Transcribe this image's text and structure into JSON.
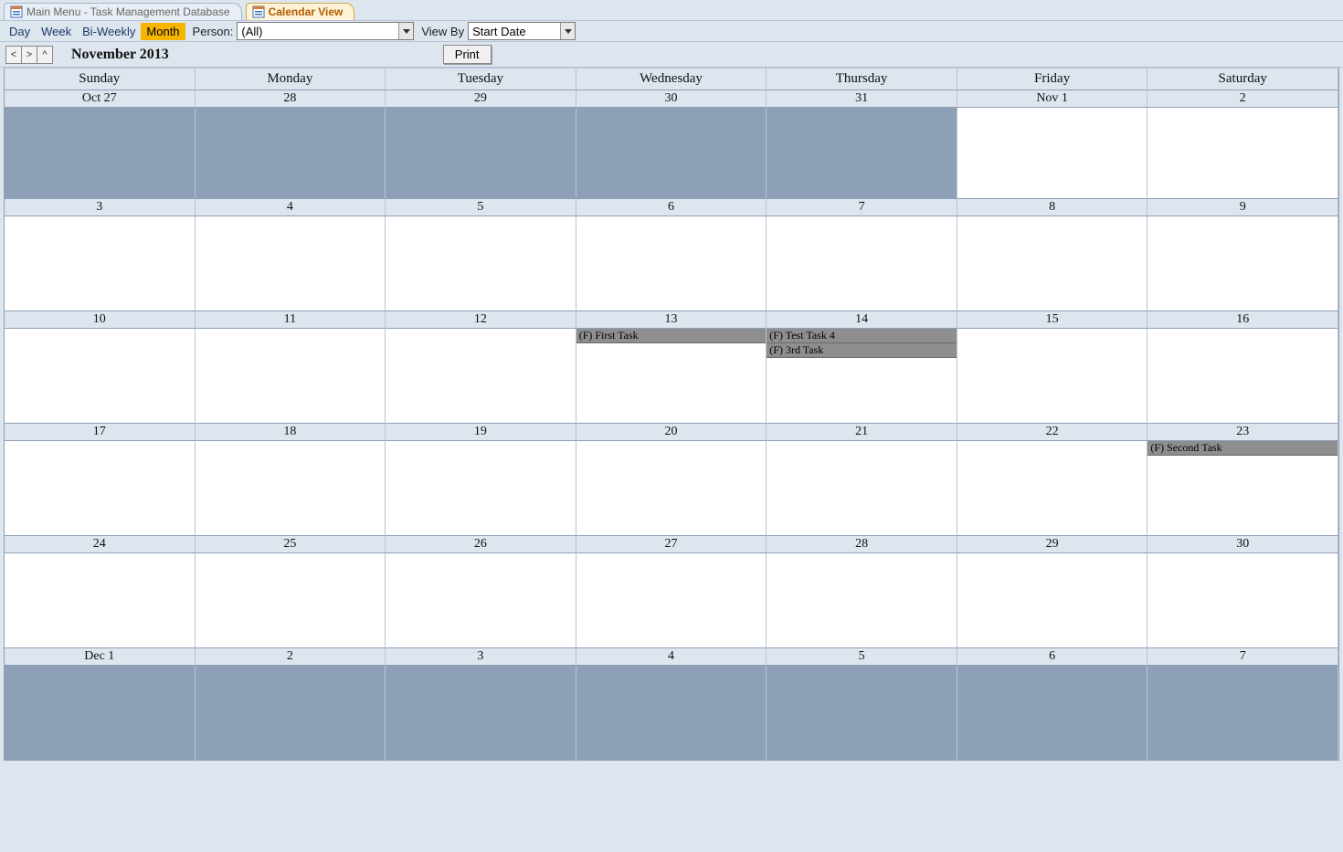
{
  "tabs": [
    {
      "label": "Main Menu - Task Management Database",
      "active": false
    },
    {
      "label": "Calendar View",
      "active": true
    }
  ],
  "toolbar": {
    "ranges": [
      "Day",
      "Week",
      "Bi-Weekly",
      "Month"
    ],
    "active_range": "Month",
    "person_label": "Person:",
    "person_value": "(All)",
    "viewby_label": "View By",
    "viewby_value": "Start Date"
  },
  "nav": {
    "prev": "<",
    "next": ">",
    "up": "^",
    "title": "November 2013",
    "print": "Print"
  },
  "days_of_week": [
    "Sunday",
    "Monday",
    "Tuesday",
    "Wednesday",
    "Thursday",
    "Friday",
    "Saturday"
  ],
  "weeks": [
    {
      "dates": [
        "Oct 27",
        "28",
        "29",
        "30",
        "31",
        "Nov 1",
        "2"
      ],
      "out": [
        true,
        true,
        true,
        true,
        true,
        false,
        false
      ],
      "special": [
        "sun27",
        "",
        "",
        "",
        "",
        "",
        ""
      ],
      "tasks": [
        [],
        [],
        [],
        [],
        [],
        [],
        []
      ]
    },
    {
      "dates": [
        "3",
        "4",
        "5",
        "6",
        "7",
        "8",
        "9"
      ],
      "out": [
        false,
        false,
        false,
        false,
        false,
        false,
        false
      ],
      "special": [
        "",
        "",
        "",
        "",
        "",
        "",
        ""
      ],
      "tasks": [
        [],
        [],
        [],
        [],
        [],
        [],
        []
      ]
    },
    {
      "dates": [
        "10",
        "11",
        "12",
        "13",
        "14",
        "15",
        "16"
      ],
      "out": [
        false,
        false,
        false,
        false,
        false,
        false,
        false
      ],
      "special": [
        "",
        "",
        "",
        "",
        "",
        "",
        ""
      ],
      "tasks": [
        [],
        [],
        [],
        [
          "(F) First Task"
        ],
        [
          "(F) Test Task 4",
          "(F) 3rd Task"
        ],
        [],
        []
      ]
    },
    {
      "dates": [
        "17",
        "18",
        "19",
        "20",
        "21",
        "22",
        "23"
      ],
      "out": [
        false,
        false,
        false,
        false,
        false,
        false,
        false
      ],
      "special": [
        "",
        "",
        "",
        "",
        "",
        "",
        ""
      ],
      "tasks": [
        [],
        [],
        [],
        [],
        [],
        [],
        [
          "(F) Second Task"
        ]
      ]
    },
    {
      "dates": [
        "24",
        "25",
        "26",
        "27",
        "28",
        "29",
        "30"
      ],
      "out": [
        false,
        false,
        false,
        false,
        false,
        false,
        false
      ],
      "special": [
        "",
        "",
        "",
        "",
        "",
        "",
        ""
      ],
      "tasks": [
        [],
        [],
        [],
        [],
        [],
        [],
        []
      ]
    },
    {
      "dates": [
        "Dec 1",
        "2",
        "3",
        "4",
        "5",
        "6",
        "7"
      ],
      "out": [
        true,
        true,
        true,
        true,
        true,
        true,
        true
      ],
      "special": [
        "",
        "",
        "",
        "",
        "",
        "",
        ""
      ],
      "tasks": [
        [],
        [],
        [],
        [],
        [],
        [],
        []
      ]
    }
  ]
}
